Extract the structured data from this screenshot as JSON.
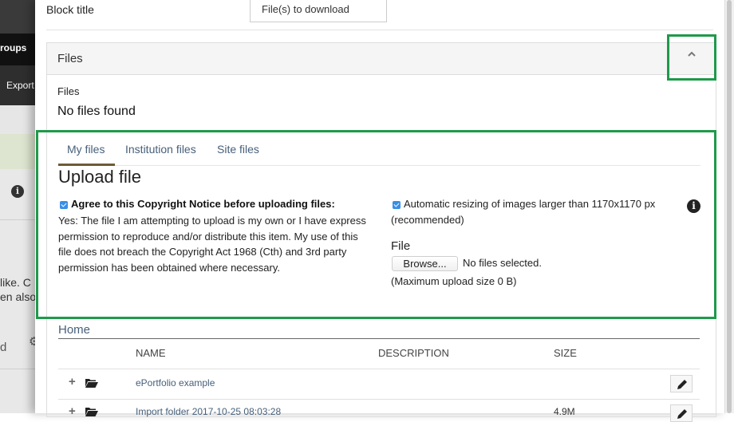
{
  "background": {
    "nav_groups": "roups",
    "nav_export": "Export",
    "info_icon_glyph": "i",
    "text_line1": "like. C",
    "text_line2": "en also",
    "bottom_text": "d",
    "gear_glyph": "⚙"
  },
  "form": {
    "block_title_label": "Block title",
    "block_title_value": "File(s) to download"
  },
  "files_panel": {
    "header_title": "Files",
    "collapse_icon": "chevron-up-icon",
    "files_label": "Files",
    "no_files_text": "No files found"
  },
  "upload": {
    "tabs": [
      {
        "label": "My files",
        "active": true
      },
      {
        "label": "Institution files",
        "active": false
      },
      {
        "label": "Site files",
        "active": false
      }
    ],
    "title": "Upload file",
    "agree_checked": true,
    "agree_label": "Agree to this Copyright Notice before uploading files:",
    "agree_text": "Yes: The file I am attempting to upload is my own or I have express permission to reproduce and/or distribute this item. My use of this file does not breach the Copyright Act 1968 (Cth) and 3rd party permission has been obtained where necessary.",
    "resize_checked": true,
    "resize_label": "Automatic resizing of images larger than 1170x1170 px",
    "resize_label2": "(recommended)",
    "info_glyph": "i",
    "file_label": "File",
    "browse_label": "Browse...",
    "no_file_selected": "No files selected.",
    "max_upload": "(Maximum upload size 0 B)"
  },
  "browser": {
    "breadcrumb_home": "Home",
    "columns": {
      "name": "NAME",
      "description": "DESCRIPTION",
      "size": "SIZE"
    },
    "rows": [
      {
        "plus": "+",
        "icon": "folder-open-icon",
        "name": "ePortfolio example",
        "description": "",
        "size": ""
      },
      {
        "plus": "+",
        "icon": "folder-open-icon",
        "name": "Import folder 2017-10-25 08:03:28",
        "description": "",
        "size": "4.9M"
      }
    ]
  },
  "colors": {
    "highlight_border": "#1e9a4a",
    "tab_active_underline": "#6e5a36",
    "link": "#47607a",
    "checkbox": "#3a8ee6"
  }
}
